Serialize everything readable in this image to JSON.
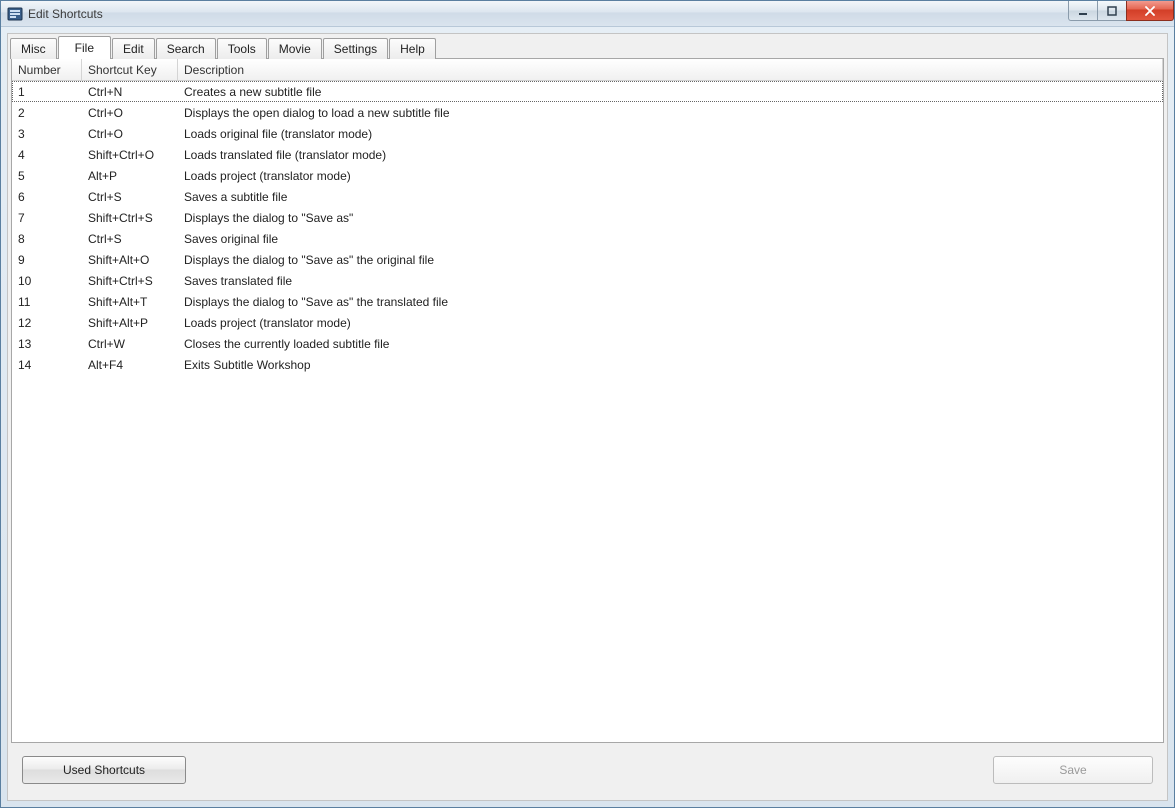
{
  "window": {
    "title": "Edit Shortcuts"
  },
  "tabs": [
    {
      "label": "Misc",
      "active": false
    },
    {
      "label": "File",
      "active": true
    },
    {
      "label": "Edit",
      "active": false
    },
    {
      "label": "Search",
      "active": false
    },
    {
      "label": "Tools",
      "active": false
    },
    {
      "label": "Movie",
      "active": false
    },
    {
      "label": "Settings",
      "active": false
    },
    {
      "label": "Help",
      "active": false
    }
  ],
  "columns": {
    "number": "Number",
    "shortcut_key": "Shortcut Key",
    "description": "Description"
  },
  "rows": [
    {
      "number": "1",
      "key": "Ctrl+N",
      "desc": "Creates a new subtitle file"
    },
    {
      "number": "2",
      "key": "Ctrl+O",
      "desc": "Displays the open dialog to load a new subtitle file"
    },
    {
      "number": "3",
      "key": "Ctrl+O",
      "desc": "Loads original file (translator mode)"
    },
    {
      "number": "4",
      "key": "Shift+Ctrl+O",
      "desc": "Loads translated file (translator mode)"
    },
    {
      "number": "5",
      "key": "Alt+P",
      "desc": "Loads project (translator mode)"
    },
    {
      "number": "6",
      "key": "Ctrl+S",
      "desc": "Saves a subtitle file"
    },
    {
      "number": "7",
      "key": "Shift+Ctrl+S",
      "desc": "Displays the dialog to \"Save as\""
    },
    {
      "number": "8",
      "key": "Ctrl+S",
      "desc": "Saves original file"
    },
    {
      "number": "9",
      "key": "Shift+Alt+O",
      "desc": "Displays the dialog to \"Save as\" the original file"
    },
    {
      "number": "10",
      "key": "Shift+Ctrl+S",
      "desc": "Saves translated file"
    },
    {
      "number": "11",
      "key": "Shift+Alt+T",
      "desc": "Displays the dialog to \"Save as\" the translated file"
    },
    {
      "number": "12",
      "key": "Shift+Alt+P",
      "desc": "Loads project (translator mode)"
    },
    {
      "number": "13",
      "key": "Ctrl+W",
      "desc": "Closes the currently loaded subtitle file"
    },
    {
      "number": "14",
      "key": "Alt+F4",
      "desc": "Exits Subtitle Workshop"
    }
  ],
  "buttons": {
    "used_shortcuts": "Used Shortcuts",
    "save": "Save"
  }
}
